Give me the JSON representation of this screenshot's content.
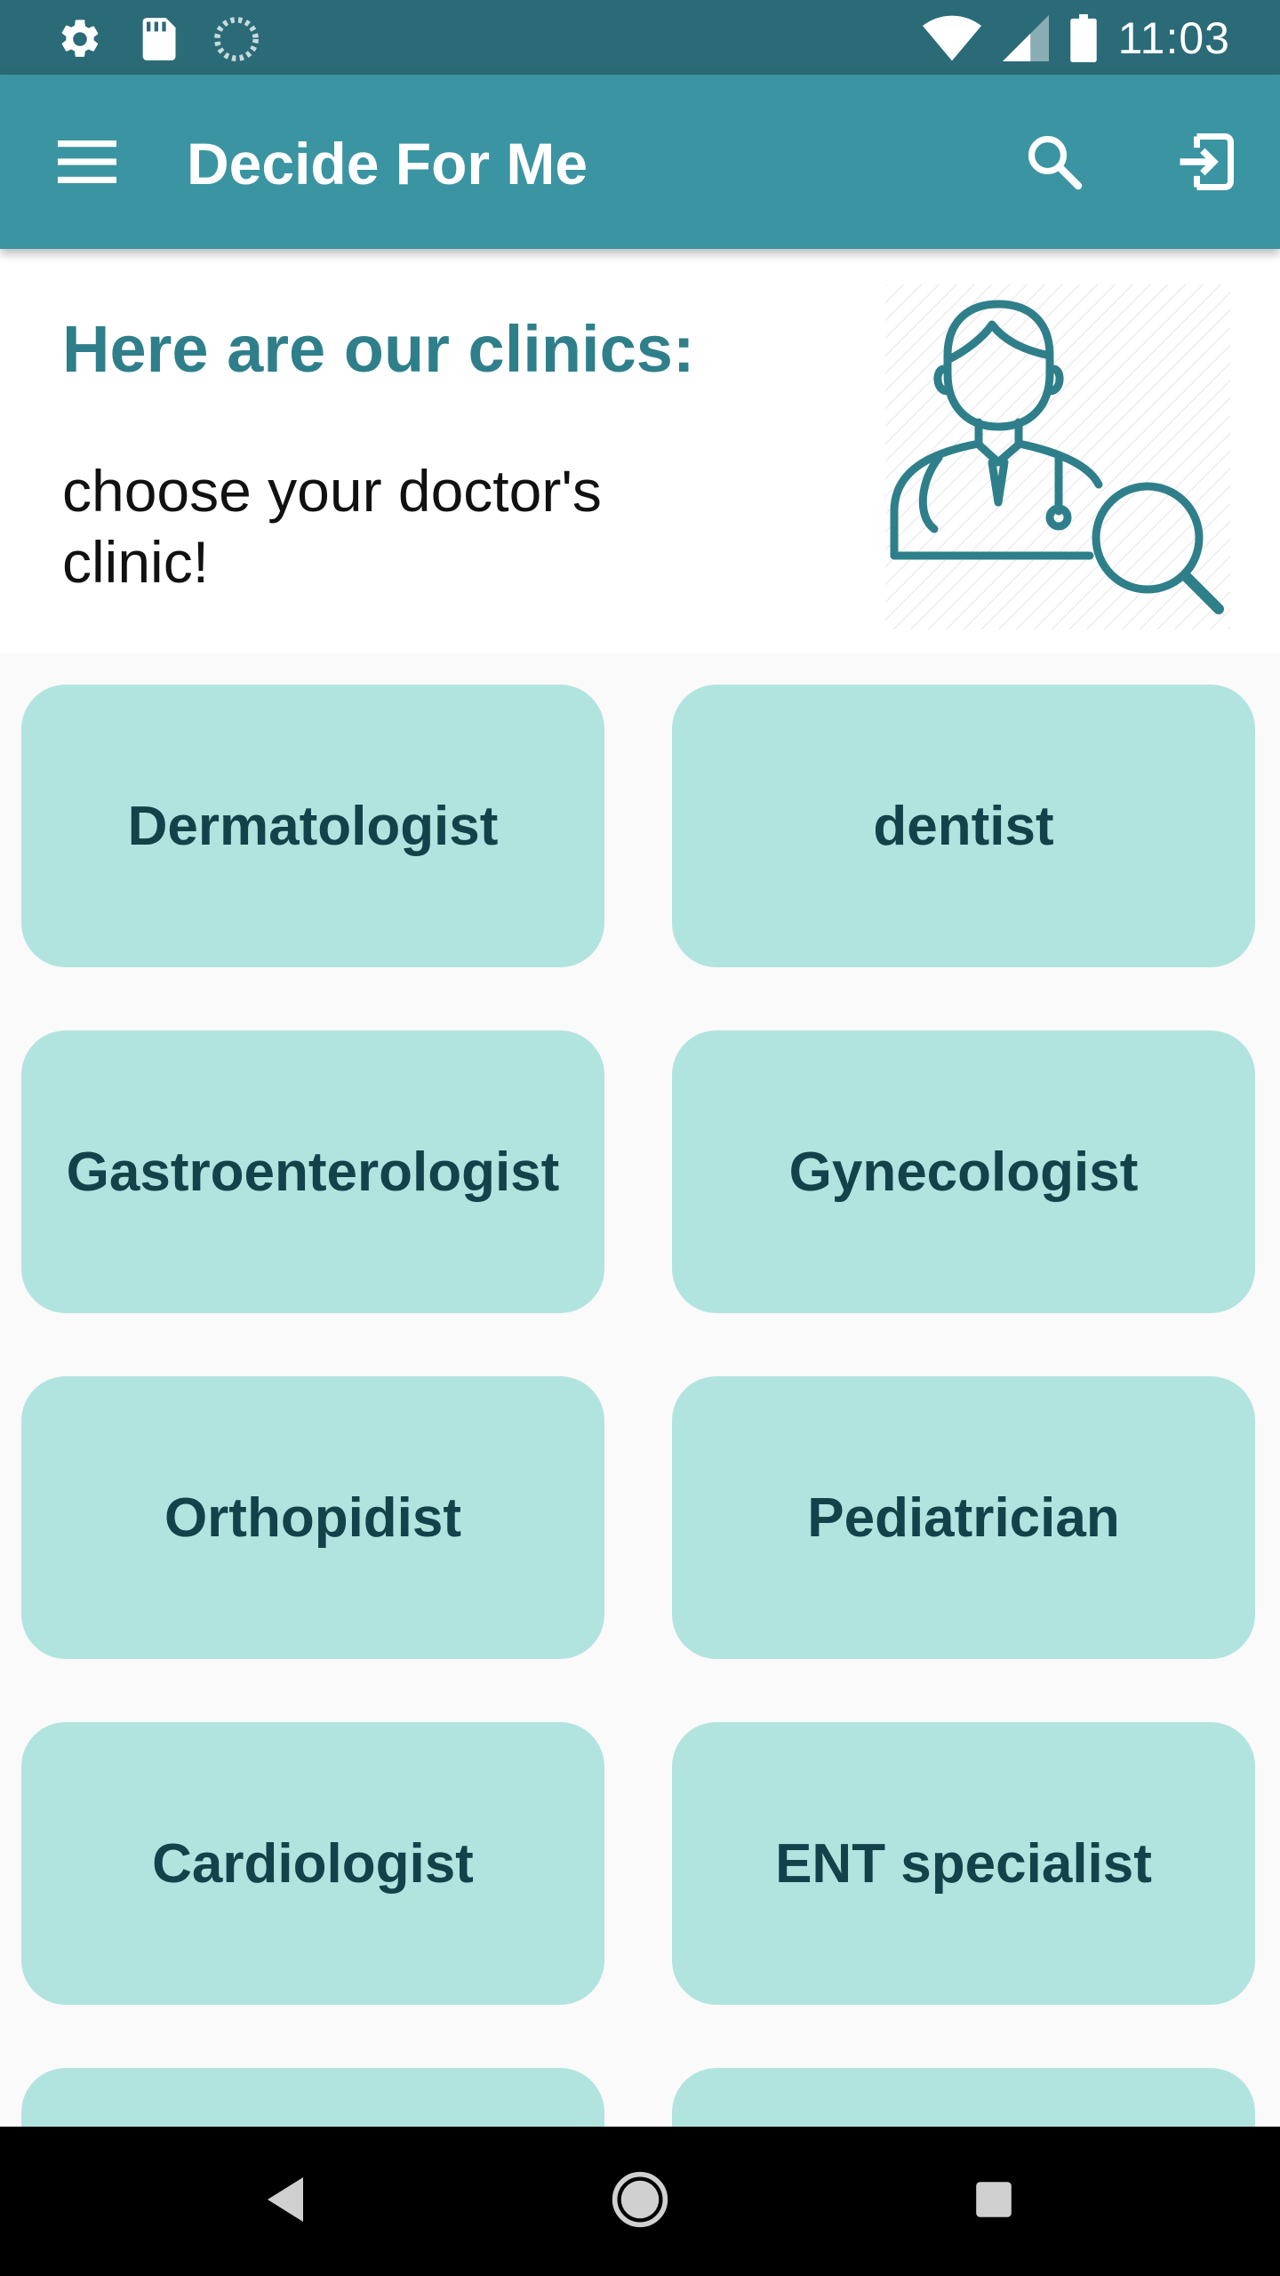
{
  "status_bar": {
    "time": "11:03",
    "left_icons": [
      "gear-icon",
      "sd-card-icon",
      "loading-icon"
    ],
    "right_icons": [
      "wifi-icon",
      "signal-icon",
      "battery-icon"
    ]
  },
  "app_bar": {
    "title": "Decide For Me",
    "icons": [
      "menu-icon",
      "search-icon",
      "logout-icon"
    ]
  },
  "header": {
    "title": "Here are our clinics:",
    "subtitle": "choose your doctor's clinic!",
    "illustration": "doctor-search-icon"
  },
  "clinics": [
    {
      "label": "Dermatologist"
    },
    {
      "label": "dentist"
    },
    {
      "label": "Gastroenterologist"
    },
    {
      "label": "Gynecologist"
    },
    {
      "label": "Orthopidist"
    },
    {
      "label": "Pediatrician"
    },
    {
      "label": "Cardiologist"
    },
    {
      "label": "ENT specialist"
    },
    {
      "label": ""
    },
    {
      "label": ""
    }
  ],
  "nav_bar": {
    "icons": [
      "back-icon",
      "home-icon",
      "recents-icon"
    ]
  },
  "colors": {
    "status_bar": "#2b6b78",
    "app_bar": "#3b94a2",
    "accent_text": "#2f7f8b",
    "card": "#b2e4df",
    "card_text": "#14424a"
  }
}
